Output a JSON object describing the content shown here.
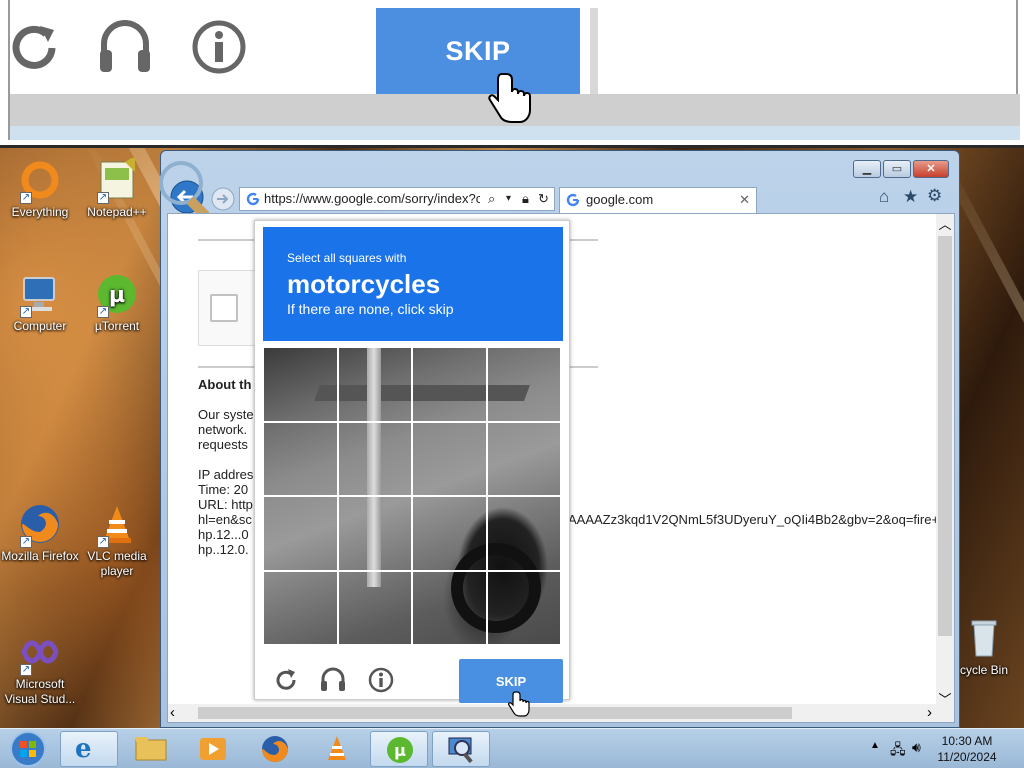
{
  "zoom": {
    "skip_label": "SKIP"
  },
  "desktop": {
    "icons": [
      {
        "label": "Everything"
      },
      {
        "label": "Notepad++"
      },
      {
        "label": "Computer"
      },
      {
        "label": "µTorrent"
      },
      {
        "label": "Mozilla Firefox"
      },
      {
        "label": "VLC media player"
      },
      {
        "label": "Microsoft Visual Stud..."
      },
      {
        "label": "cycle Bin"
      }
    ]
  },
  "browser": {
    "url": "https://www.google.com/sorry/index?cor",
    "tab_title": "google.com",
    "page": {
      "about_heading": "About th",
      "para1_l1": "Our syste",
      "para1_l2": "network.",
      "para1_l3": "requests",
      "ip_label": "IP addres",
      "time_label": "Time: 20",
      "url_label": "URL: http",
      "url_l2_left": "hl=en&sc",
      "url_l2_right": "AAAAZz3kqd1V2QNmL5f3UDyeruY_oQIi4Bb2&gbv=2&oq=fire+",
      "url_l3": "hp.12...0",
      "url_l4": "hp..12.0."
    }
  },
  "captcha": {
    "line1": "Select all squares with",
    "target": "motorcycles",
    "line3": "If there are none, click skip",
    "skip_label": "SKIP"
  },
  "taskbar": {
    "time": "10:30 AM",
    "date": "11/20/2024"
  }
}
